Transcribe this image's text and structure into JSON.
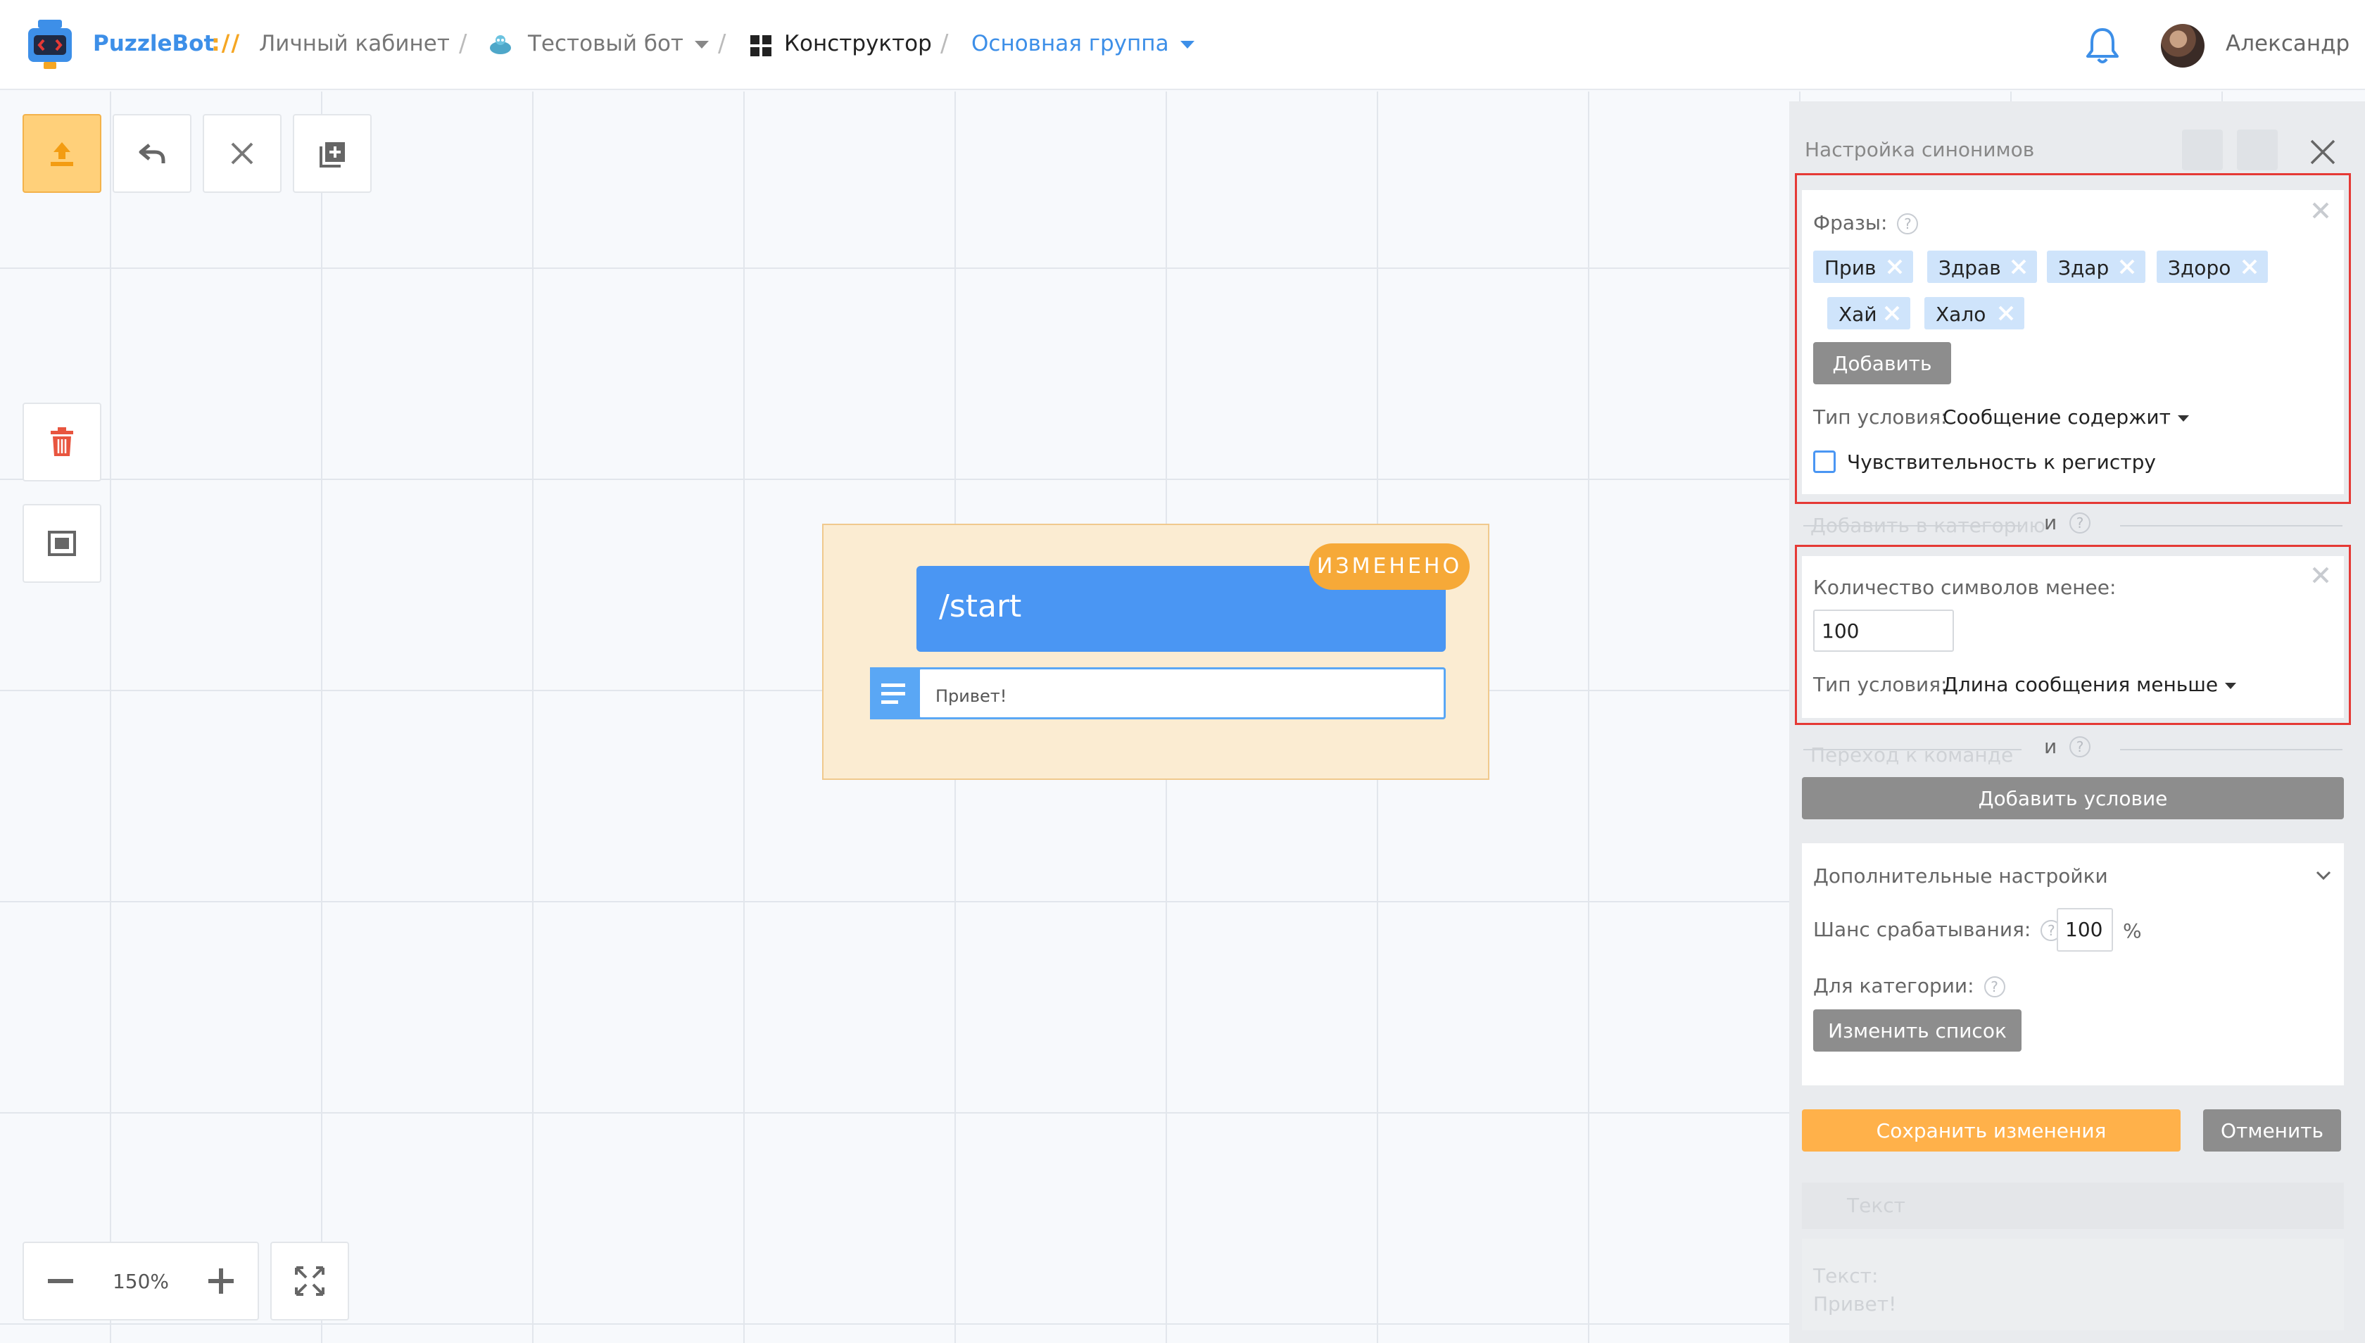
{
  "header": {
    "brand": "PuzzleBot",
    "brand_separator": "://",
    "crumbs": {
      "cabinet": "Личный кабинет",
      "bot": "Тестовый бот",
      "constructor": "Конструктор",
      "group": "Основная группа"
    },
    "user_name": "Александр"
  },
  "toolbar": {
    "icons": [
      "upload-icon",
      "undo-icon",
      "close-icon",
      "add-block-icon",
      "trash-icon",
      "frame-icon"
    ]
  },
  "zoom": {
    "level": "150%"
  },
  "node": {
    "command": "/start",
    "badge": "ИЗМЕНЕНО",
    "message": "Привет!"
  },
  "panel": {
    "title": "Настройка синонимов",
    "condition1": {
      "phrases_label": "Фразы:",
      "phrases": [
        "Прив",
        "Здрав",
        "Здар",
        "Здоро",
        "Хай",
        "Хало"
      ],
      "add_button": "Добавить",
      "condition_type_label": "Тип условия:",
      "condition_type_value": "Сообщение содержит",
      "case_sensitive_label": "Чувствительность к регистру",
      "case_sensitive": false
    },
    "connector1": {
      "faded_text": "Добавить в категорию",
      "and": "и"
    },
    "condition2": {
      "length_label": "Количество символов менее:",
      "length_value": "100",
      "condition_type_label": "Тип условия:",
      "condition_type_value": "Длина сообщения меньше"
    },
    "connector2": {
      "faded_text": "Переход к команде",
      "and": "и"
    },
    "add_condition_button": "Добавить условие",
    "extra": {
      "title": "Дополнительные настройки",
      "chance_label": "Шанс срабатывания:",
      "chance_value": "100",
      "chance_unit": "%",
      "category_label": "Для категории:",
      "change_list_button": "Изменить список"
    },
    "save_button": "Сохранить изменения",
    "cancel_button": "Отменить",
    "ghost": {
      "block_title": "Текст",
      "text_label": "Текст:",
      "text_value": "Привет!"
    }
  },
  "colors": {
    "brand_blue": "#3d8fe8",
    "accent_orange": "#f6a938",
    "highlight_red": "#e53935"
  }
}
